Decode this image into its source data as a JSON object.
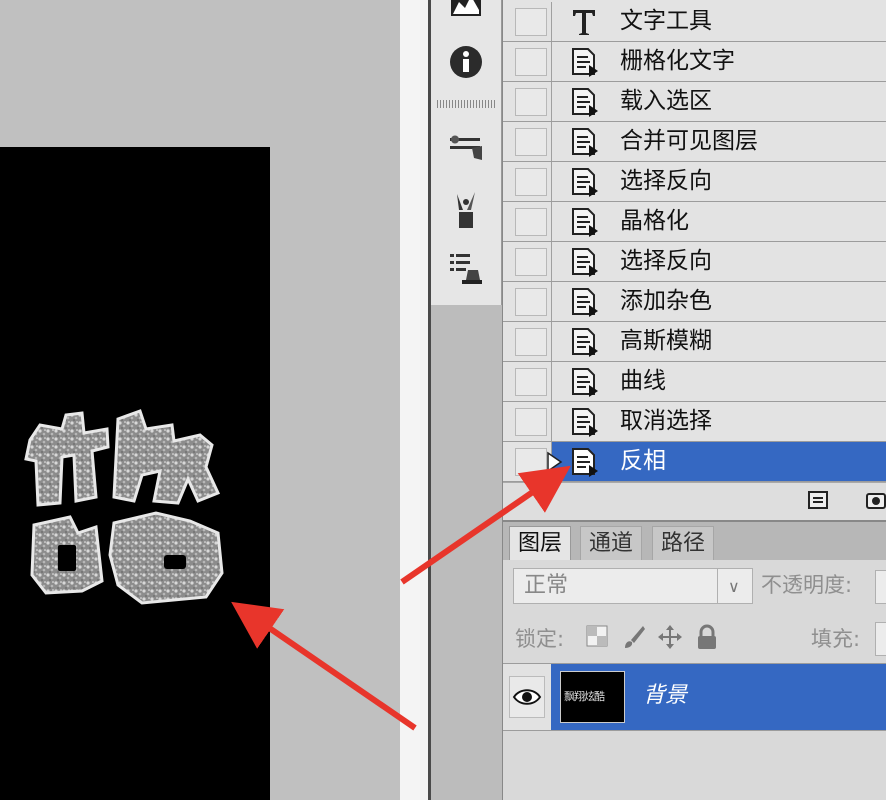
{
  "history": {
    "items": [
      {
        "label": "文字工具",
        "icon": "type-tool-icon"
      },
      {
        "label": "栅格化文字",
        "icon": "history-state-icon"
      },
      {
        "label": "载入选区",
        "icon": "history-state-icon"
      },
      {
        "label": "合并可见图层",
        "icon": "history-state-icon"
      },
      {
        "label": "选择反向",
        "icon": "history-state-icon"
      },
      {
        "label": "晶格化",
        "icon": "history-state-icon"
      },
      {
        "label": "选择反向",
        "icon": "history-state-icon"
      },
      {
        "label": "添加杂色",
        "icon": "history-state-icon"
      },
      {
        "label": "高斯模糊",
        "icon": "history-state-icon"
      },
      {
        "label": "曲线",
        "icon": "history-state-icon"
      },
      {
        "label": "取消选择",
        "icon": "history-state-icon"
      },
      {
        "label": "反相",
        "icon": "history-state-icon",
        "selected": true
      }
    ]
  },
  "layers_panel": {
    "tabs": [
      "图层",
      "通道",
      "路径"
    ],
    "active_tab": "图层",
    "blend_mode": "正常",
    "opacity_label": "不透明度:",
    "lock_label": "锁定:",
    "fill_label": "填充:",
    "layer": {
      "name": "背景",
      "thumbnail_text": "飘翔炫酷"
    }
  },
  "colors": {
    "selection": "#3568c2",
    "panel_bg": "#e3e3e3",
    "arrow": "#e8352b",
    "canvas_bg": "#000000"
  }
}
